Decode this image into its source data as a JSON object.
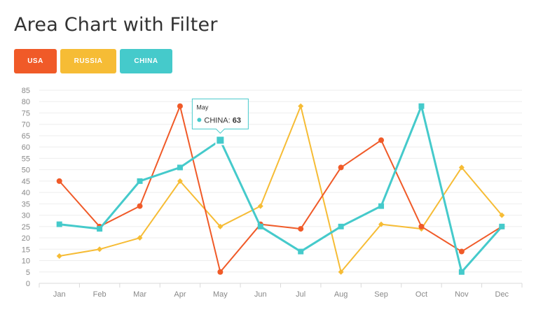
{
  "page": {
    "title": "Area Chart with Filter"
  },
  "filters": [
    {
      "label": "USA",
      "color": "#F05A28"
    },
    {
      "label": "RUSSIA",
      "color": "#F6BC35"
    },
    {
      "label": "CHINA",
      "color": "#45CACB"
    }
  ],
  "tooltip": {
    "month": "May",
    "series": "CHINA",
    "value": "63"
  },
  "chart_data": {
    "type": "line",
    "categories": [
      "Jan",
      "Feb",
      "Mar",
      "Apr",
      "May",
      "Jun",
      "Jul",
      "Aug",
      "Sep",
      "Oct",
      "Nov",
      "Dec"
    ],
    "ylim": [
      0,
      85
    ],
    "yticks": [
      0,
      5,
      10,
      15,
      20,
      25,
      30,
      35,
      40,
      45,
      50,
      55,
      60,
      65,
      70,
      75,
      80,
      85
    ],
    "grid": true,
    "series": [
      {
        "name": "USA",
        "color": "#F05A28",
        "marker": "circle",
        "values": [
          45,
          25,
          34,
          78,
          5,
          26,
          24,
          51,
          63,
          25,
          14,
          25
        ]
      },
      {
        "name": "RUSSIA",
        "color": "#F6BC35",
        "marker": "diamond",
        "values": [
          12,
          15,
          20,
          45,
          25,
          34,
          78,
          5,
          26,
          24,
          51,
          30
        ]
      },
      {
        "name": "CHINA",
        "color": "#45CACB",
        "marker": "square",
        "values": [
          26,
          24,
          45,
          51,
          63,
          25,
          14,
          25,
          34,
          78,
          5,
          25
        ]
      }
    ]
  }
}
